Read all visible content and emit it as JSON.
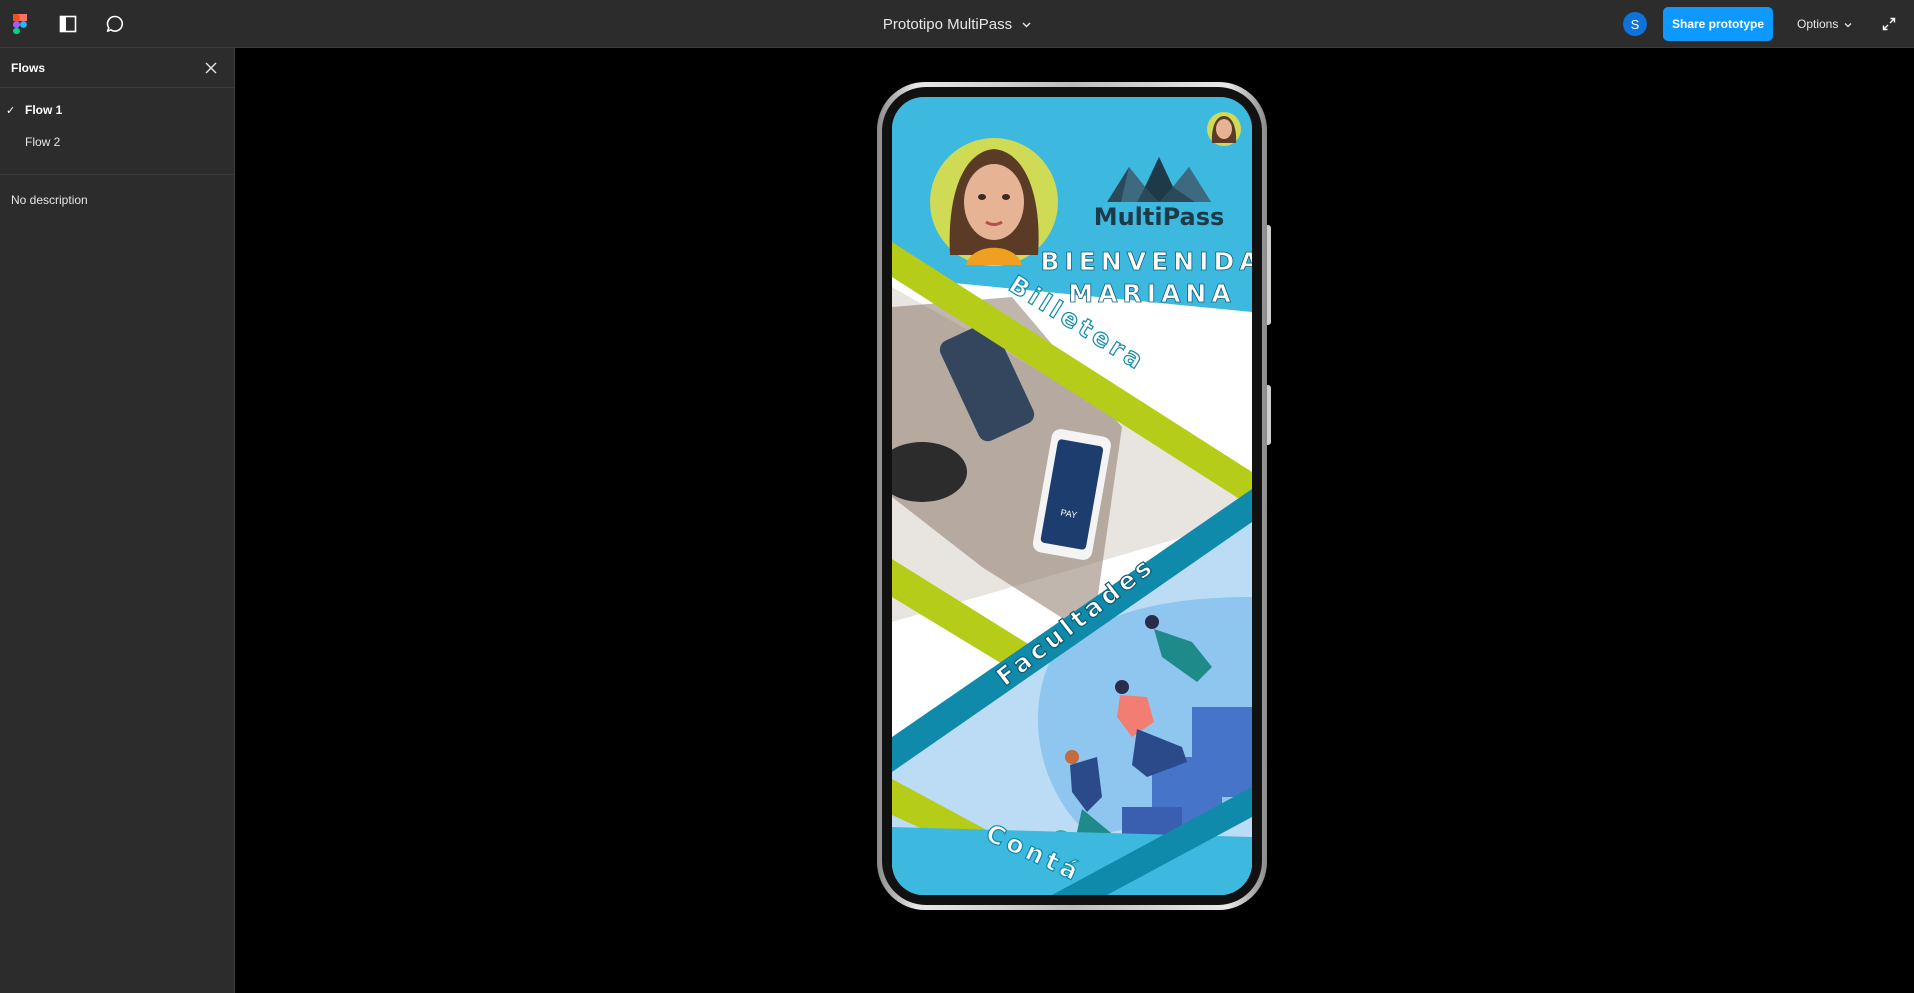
{
  "topbar": {
    "title": "Prototipo MultiPass",
    "avatar_letter": "S",
    "share_label": "Share prototype",
    "options_label": "Options"
  },
  "sidebar": {
    "title": "Flows",
    "flows": [
      {
        "label": "Flow 1",
        "selected": true
      },
      {
        "label": "Flow 2",
        "selected": false
      }
    ],
    "description": "No description"
  },
  "screen": {
    "brand": "MultiPass",
    "welcome_line1": "BIENVENIDA",
    "welcome_line2": "MARIANA",
    "band1": "Billetera",
    "band2": "Facultades",
    "band3": "Contá",
    "pay_label": "PAY"
  },
  "colors": {
    "accent": "#0d99ff",
    "sky": "#3db8de",
    "lime": "#b5cc18",
    "teal": "#0f8aaa"
  }
}
